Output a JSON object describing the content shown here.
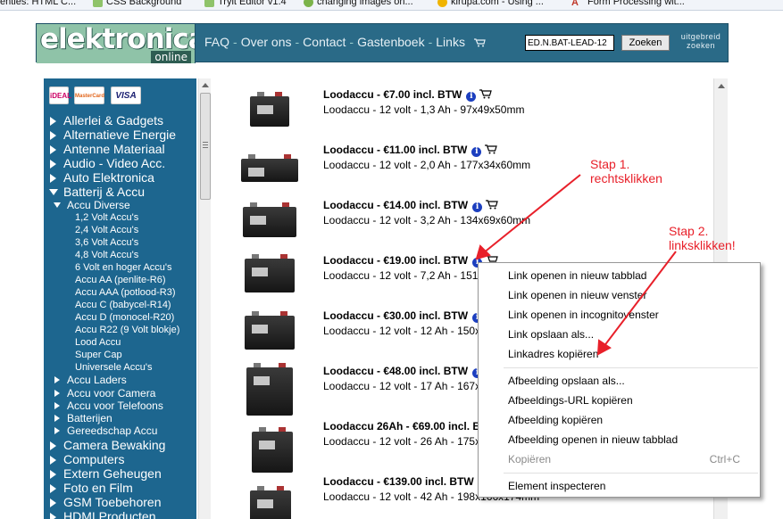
{
  "bookmarks": [
    {
      "label": "enties: HTML C...",
      "icon": "page-icon",
      "color": "#d9d9d9"
    },
    {
      "label": "CSS Background",
      "icon": "css-icon",
      "color": "#8fc36a"
    },
    {
      "label": "Tryit Editor v1.4",
      "icon": "tryit-icon",
      "color": "#8fc36a"
    },
    {
      "label": "changing images on...",
      "icon": "leaf-icon",
      "color": "#7bb34a"
    },
    {
      "label": "kirupa.com - Using ...",
      "icon": "kirupa-icon",
      "color": "#f0b400"
    },
    {
      "label": "Form Processing wit...",
      "icon": "at-icon",
      "color": "#c0392b"
    }
  ],
  "header": {
    "logo_main": "elektronica",
    "logo_sub": "online",
    "nav": [
      "FAQ",
      "Over ons",
      "Contact",
      "Gastenboek",
      "Links"
    ],
    "nav_sep": "-",
    "search_value": "ED.N.BAT-LEAD-12",
    "search_button": "Zoeken",
    "advanced_line1": "uitgebreid",
    "advanced_line2": "zoeken"
  },
  "sidebar": {
    "payments": [
      "iDEAL",
      "MasterCard",
      "VISA"
    ],
    "categories_top": [
      "Allerlei & Gadgets",
      "Alternatieve Energie",
      "Antenne Materiaal",
      "Audio - Video Acc.",
      "Auto Elektronica"
    ],
    "open_category": "Batterij & Accu",
    "open_sub": "Accu Diverse",
    "accu_diverse": [
      "1,2 Volt Accu's",
      "2,4 Volt Accu's",
      "3,6 Volt Accu's",
      "4,8 Volt Accu's",
      "6 Volt en hoger Accu's",
      "Accu AA (penlite-R6)",
      "Accu AAA (potlood-R3)",
      "Accu C (babycel-R14)",
      "Accu D (monocel-R20)",
      "Accu R22 (9 Volt blokje)",
      "Lood Accu",
      "Super Cap",
      "Universele Accu's"
    ],
    "batterij_subs": [
      "Accu Laders",
      "Accu voor Camera",
      "Accu voor Telefoons",
      "Batterijen",
      "Gereedschap Accu"
    ],
    "categories_bottom": [
      "Camera Bewaking",
      "Computers",
      "Extern Geheugen",
      "Foto en Film",
      "GSM Toebehoren",
      "HDMI Producten"
    ]
  },
  "products": [
    {
      "title": "Loodaccu - €7.00 incl. BTW",
      "desc": "Loodaccu - 12 volt - 1,3 Ah - 97x49x50mm"
    },
    {
      "title": "Loodaccu - €11.00 incl. BTW",
      "desc": "Loodaccu - 12 volt - 2,0 Ah - 177x34x60mm"
    },
    {
      "title": "Loodaccu - €14.00 incl. BTW",
      "desc": "Loodaccu - 12 volt - 3,2 Ah - 134x69x60mm"
    },
    {
      "title": "Loodaccu - €19.00 incl. BTW",
      "desc": "Loodaccu - 12 volt - 7,2 Ah - 151"
    },
    {
      "title": "Loodaccu - €30.00 incl. BTW",
      "desc": "Loodaccu - 12 volt - 12 Ah - 150x"
    },
    {
      "title": "Loodaccu - €48.00 incl. BTW",
      "desc": "Loodaccu - 12 volt - 17 Ah - 167x"
    },
    {
      "title": "Loodaccu 26Ah - €69.00 incl. B",
      "desc": "Loodaccu - 12 volt - 26 Ah - 175x"
    },
    {
      "title": "Loodaccu - €139.00 incl. BTW",
      "desc": "Loodaccu - 12 volt - 42 Ah - 198x166x174mm"
    }
  ],
  "annotations": {
    "step1_line1": "Stap 1.",
    "step1_line2": "rechtsklikken",
    "step2_line1": "Stap 2.",
    "step2_line2": "linksklikken!",
    "color": "#e8202a"
  },
  "context_menu": {
    "items": [
      "Link openen in nieuw tabblad",
      "Link openen in nieuw venster",
      "Link openen in incognitovenster",
      "Link opslaan als...",
      "Linkadres kopiëren",
      "Afbeelding opslaan als...",
      "Afbeeldings-URL kopiëren",
      "Afbeelding kopiëren",
      "Afbeelding openen in nieuw tabblad",
      "Kopiëren",
      "Element inspecteren"
    ],
    "copy_shortcut": "Ctrl+C"
  }
}
